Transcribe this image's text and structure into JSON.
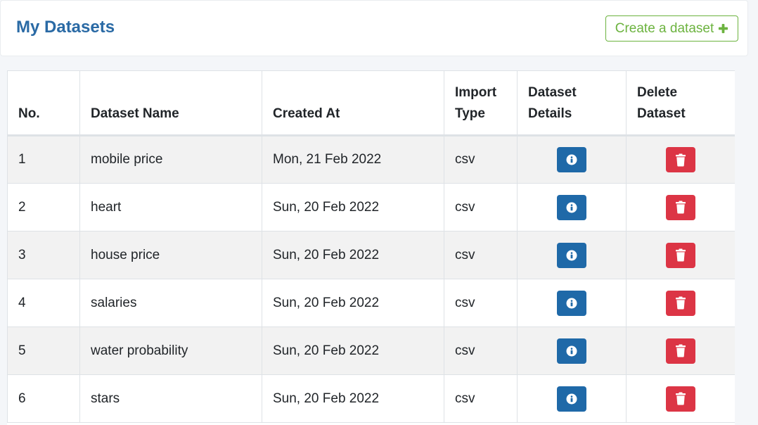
{
  "header": {
    "title": "My Datasets",
    "create_button_label": "Create a dataset"
  },
  "table": {
    "columns": [
      "No.",
      "Dataset Name",
      "Created At",
      "Import Type",
      "Dataset Details",
      "Delete Dataset"
    ],
    "rows": [
      {
        "no": "1",
        "name": "mobile price",
        "created_at": "Mon, 21 Feb 2022",
        "type": "csv"
      },
      {
        "no": "2",
        "name": "heart",
        "created_at": "Sun, 20 Feb 2022",
        "type": "csv"
      },
      {
        "no": "3",
        "name": "house price",
        "created_at": "Sun, 20 Feb 2022",
        "type": "csv"
      },
      {
        "no": "4",
        "name": "salaries",
        "created_at": "Sun, 20 Feb 2022",
        "type": "csv"
      },
      {
        "no": "5",
        "name": "water probability",
        "created_at": "Sun, 20 Feb 2022",
        "type": "csv"
      },
      {
        "no": "6",
        "name": "stars",
        "created_at": "Sun, 20 Feb 2022",
        "type": "csv"
      }
    ]
  },
  "icons": {
    "create": "plus-icon",
    "details": "info-icon",
    "delete": "trash-icon"
  },
  "colors": {
    "title": "#2a6aa5",
    "create_accent": "#6cb33f",
    "info_button": "#1f69a8",
    "delete_button": "#dc3545",
    "stripe": "#f2f2f2"
  }
}
